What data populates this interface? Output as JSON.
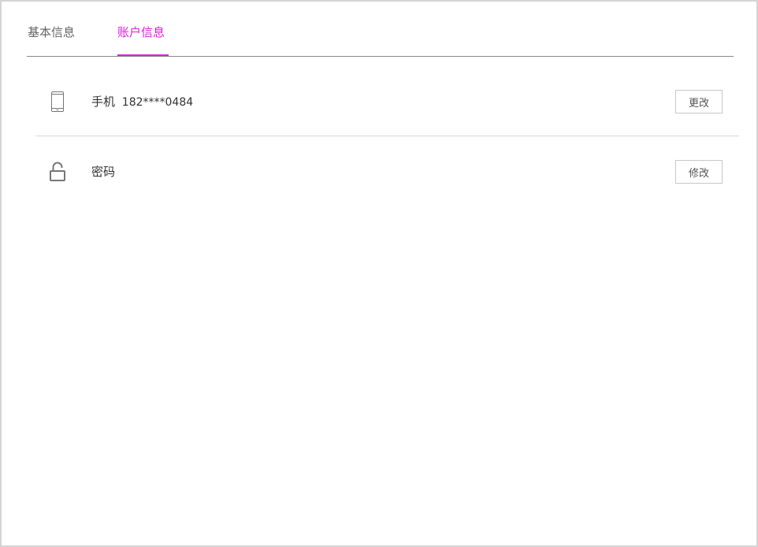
{
  "tabs": [
    {
      "label": "基本信息",
      "active": false
    },
    {
      "label": "账户信息",
      "active": true
    }
  ],
  "colors": {
    "accent": "#e01ee0",
    "text": "#333333",
    "muted": "#666666"
  },
  "rows": [
    {
      "icon": "mobile-phone-icon",
      "label": "手机",
      "value": "182****0484",
      "button": "更改"
    },
    {
      "icon": "unlocked-padlock-icon",
      "label": "密码",
      "value": "",
      "button": "修改"
    }
  ]
}
